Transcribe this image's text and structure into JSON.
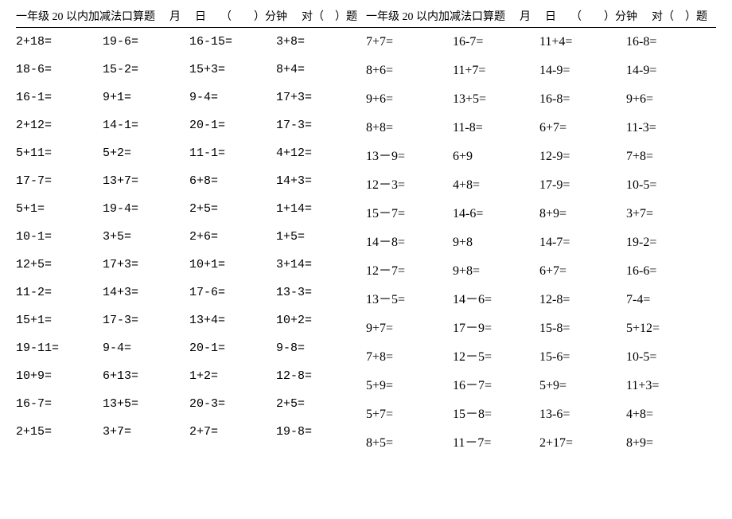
{
  "header": {
    "title": "一年级 20 以内加减法口算题",
    "month_label": "月",
    "day_label": "日",
    "minutes_label": "（　　）分钟",
    "correct_label": "对（　）题"
  },
  "left": [
    [
      "2+18=",
      "19-6=",
      "16-15=",
      "3+8="
    ],
    [
      "18-6=",
      "15-2=",
      "15+3=",
      "8+4="
    ],
    [
      "16-1=",
      "9+1=",
      "9-4=",
      "17+3="
    ],
    [
      "2+12=",
      "14-1=",
      "20-1=",
      "17-3="
    ],
    [
      "5+11=",
      "5+2=",
      "11-1=",
      "4+12="
    ],
    [
      "17-7=",
      "13+7=",
      "6+8=",
      "14+3="
    ],
    [
      "5+1=",
      "19-4=",
      "2+5=",
      "1+14="
    ],
    [
      "10-1=",
      "3+5=",
      "2+6=",
      "1+5="
    ],
    [
      "12+5=",
      "17+3=",
      "10+1=",
      "3+14="
    ],
    [
      "11-2=",
      "14+3=",
      "17-6=",
      "13-3="
    ],
    [
      "15+1=",
      "17-3=",
      "13+4=",
      "10+2="
    ],
    [
      "19-11=",
      "9-4=",
      "20-1=",
      "9-8="
    ],
    [
      "10+9=",
      "6+13=",
      "1+2=",
      "12-8="
    ],
    [
      "16-7=",
      "13+5=",
      "20-3=",
      "2+5="
    ],
    [
      "2+15=",
      "3+7=",
      "2+7=",
      "19-8="
    ]
  ],
  "right": [
    [
      "7+7=",
      "16-7=",
      "11+4=",
      "16-8="
    ],
    [
      "8+6=",
      "11+7=",
      "14-9=",
      "14-9="
    ],
    [
      "9+6=",
      "13+5=",
      "16-8=",
      "9+6="
    ],
    [
      "8+8=",
      "11-8=",
      "6+7=",
      "11-3="
    ],
    [
      "13－9=",
      "6+9",
      "12-9=",
      "7+8="
    ],
    [
      "12－3=",
      "4+8=",
      "17-9=",
      "10-5="
    ],
    [
      "15－7=",
      "14-6=",
      "8+9=",
      "3+7="
    ],
    [
      "14－8=",
      "9+8",
      "14-7=",
      "19-2="
    ],
    [
      "12－7=",
      "9+8=",
      "6+7=",
      "16-6="
    ],
    [
      "13－5=",
      "14－6=",
      "12-8=",
      "7-4="
    ],
    [
      "9+7=",
      "17－9=",
      "15-8=",
      "5+12="
    ],
    [
      "7+8=",
      "12－5=",
      "15-6=",
      "10-5="
    ],
    [
      "5+9=",
      "16－7=",
      "5+9=",
      "11+3="
    ],
    [
      "5+7=",
      "15－8=",
      "13-6=",
      "4+8="
    ],
    [
      "8+5=",
      "11－7=",
      "2+17=",
      "8+9="
    ]
  ]
}
